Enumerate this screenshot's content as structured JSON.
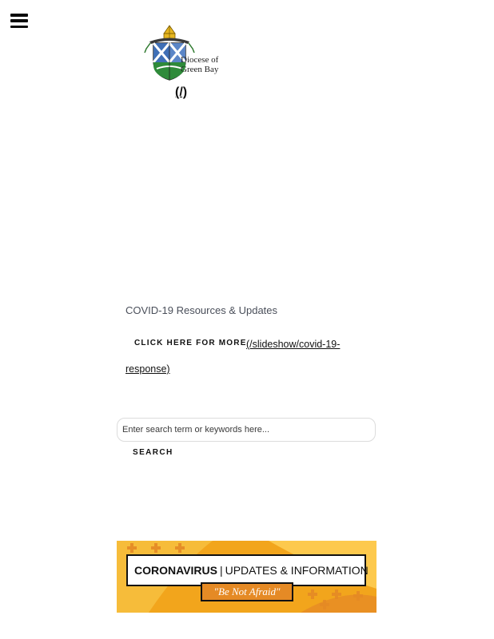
{
  "header": {
    "menu_icon": "hamburger-menu-icon",
    "logo": {
      "icon": "diocese-crest-icon",
      "line1": "Diocese of",
      "line2": "Green Bay"
    },
    "home_link": "(/)"
  },
  "covid": {
    "heading": "COVID-19 Resources & Updates",
    "cta_label": "CLICK HERE FOR MORE",
    "link_line1": "(/slideshow/covid-19-",
    "link_line2": "response)"
  },
  "search": {
    "placeholder": "Enter search term or keywords here...",
    "button_label": "SEARCH"
  },
  "banner": {
    "title_bold": "CORONAVIRUS",
    "separator": "|",
    "title_rest": "UPDATES & INFORMATION",
    "tagline": "\"Be Not Afraid\"",
    "colors": {
      "background": "#f2a51c",
      "pattern": "#e58a25",
      "tag": "#e58a25"
    }
  },
  "colors": {
    "text": "#111111",
    "muted": "#4a4f5a",
    "border": "#dcdcdc"
  }
}
